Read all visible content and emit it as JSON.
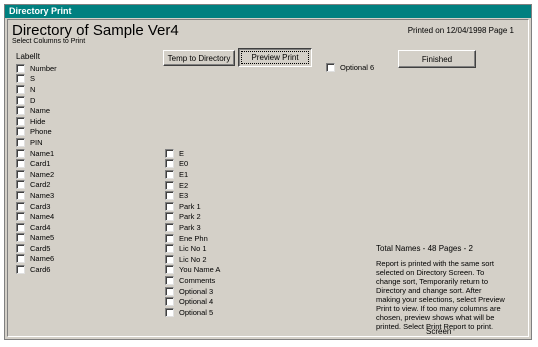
{
  "window": {
    "title": "Directory Print",
    "heading": "Directory of Sample Ver4",
    "printed_text": "Printed on 12/04/1998 Page 1",
    "subtitle": "Select Columns to Print",
    "label_header": "LabelIt"
  },
  "buttons": {
    "temp_to_directory": "Temp to Directory",
    "preview_print": "Preview Print",
    "finished": "Finished"
  },
  "optional6_label": "Optional 6",
  "column1": [
    "Number",
    "S",
    "N",
    "D",
    "Name",
    "Hide",
    "Phone",
    "PIN",
    "Name1",
    "Card1",
    "Name2",
    "Card2",
    "Name3",
    "Card3",
    "Name4",
    "Card4",
    "Name5",
    "Card5",
    "Name6",
    "Card6"
  ],
  "column2": [
    "E",
    "E0",
    "E1",
    "E2",
    "E3",
    "Park 1",
    "Park 2",
    "Park 3",
    "Ene Phn",
    "Lic No 1",
    "Lic No 2",
    "You Name A",
    "Comments",
    "Optional 3",
    "Optional 4",
    "Optional 5"
  ],
  "totals": "Total Names - 48 Pages - 2",
  "info_text": "Report is printed with the same sort selected on Directory Screen. To change sort, Temporarily return to Directory and change sort. After making your selections, select Preview Print to view. If too many columns are chosen, preview shows what will be printed. Select Print Report to print.",
  "screen_label": "Screen"
}
